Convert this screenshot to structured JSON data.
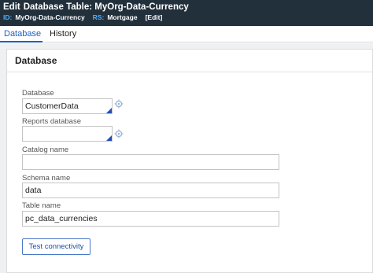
{
  "header": {
    "edit_label": "Edit",
    "title": "Database Table: MyOrg-Data-Currency",
    "id_key": "ID:",
    "id_value": "MyOrg-Data-Currency",
    "rs_key": "RS:",
    "rs_value": "Mortgage",
    "edit_link": "[Edit]"
  },
  "tabs": [
    {
      "label": "Database",
      "active": true
    },
    {
      "label": "History",
      "active": false
    }
  ],
  "panel": {
    "title": "Database"
  },
  "fields": {
    "database": {
      "label": "Database",
      "value": "CustomerData"
    },
    "reports_database": {
      "label": "Reports database",
      "value": ""
    },
    "catalog_name": {
      "label": "Catalog name",
      "value": ""
    },
    "schema_name": {
      "label": "Schema name",
      "value": "data"
    },
    "table_name": {
      "label": "Table name",
      "value": "pc_data_currencies"
    }
  },
  "actions": {
    "test_connectivity": "Test connectivity"
  },
  "colors": {
    "header_bg": "#22303c",
    "accent": "#1e5fbf",
    "id_key": "#4fb0ff"
  },
  "icons": {
    "database_gear": "gear-icon",
    "reports_gear": "gear-icon"
  }
}
